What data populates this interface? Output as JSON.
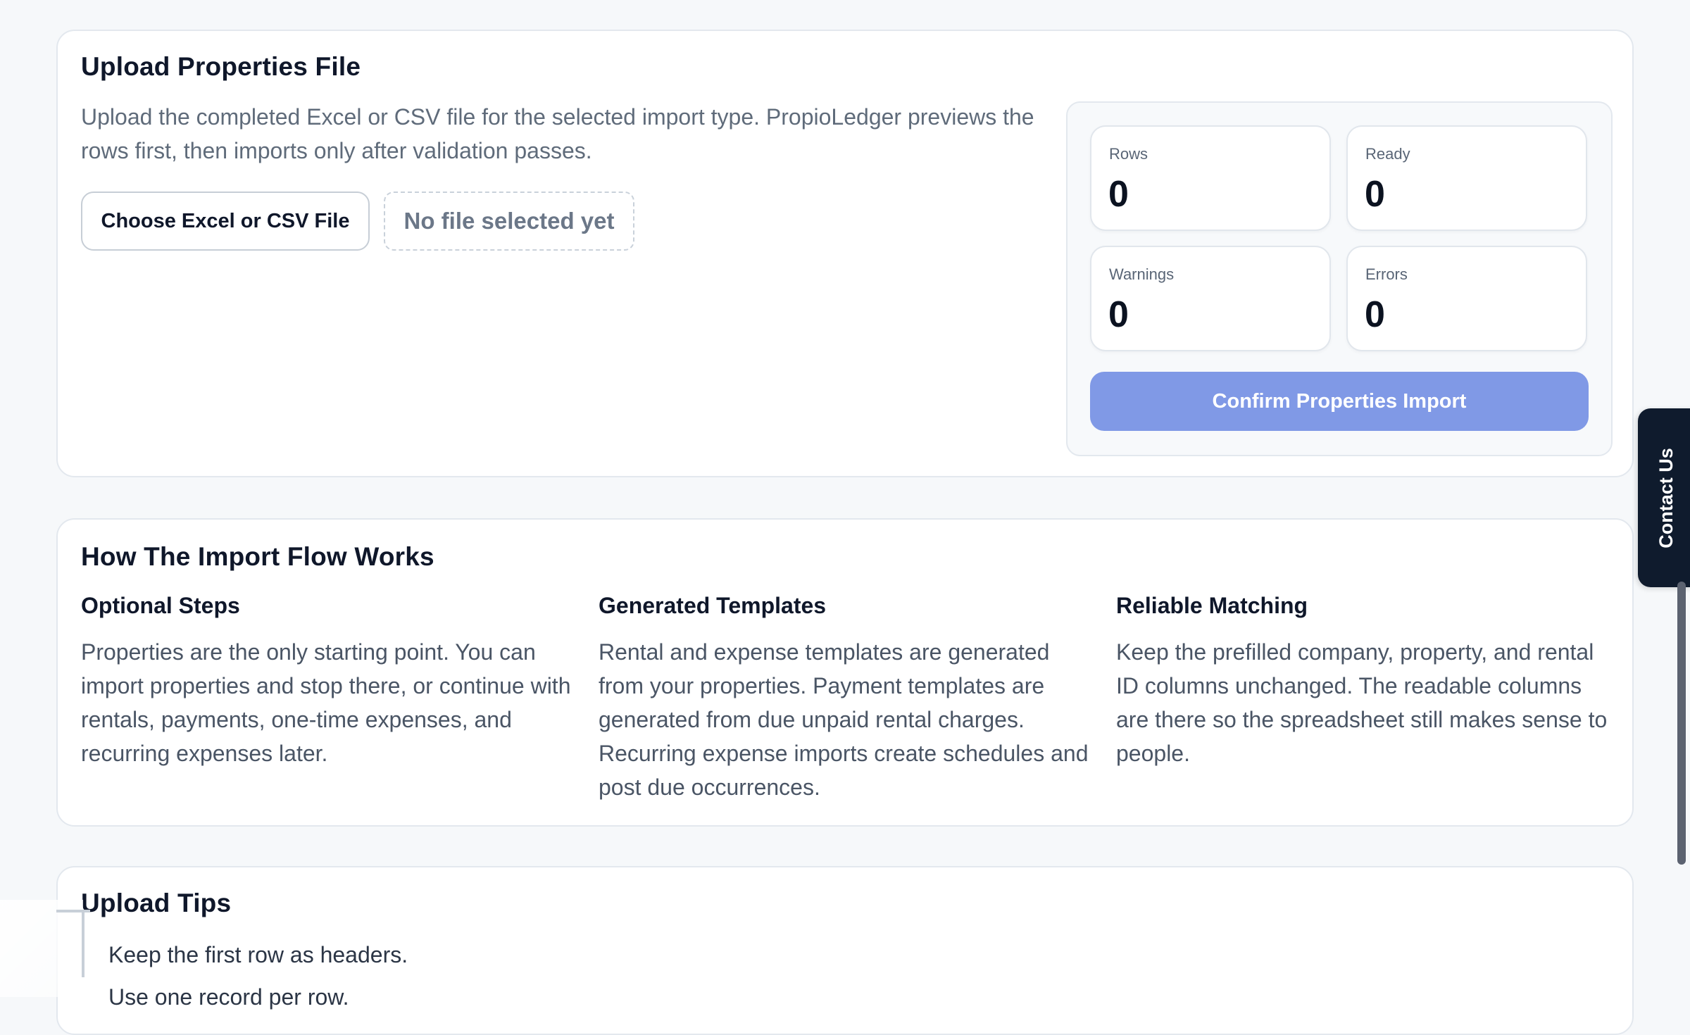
{
  "upload": {
    "title": "Upload Properties File",
    "intro": "Upload the completed Excel or CSV file for the selected import type. PropioLedger previews the rows first, then imports only after validation passes.",
    "choose_button": "Choose Excel or CSV File",
    "file_status": "No file selected yet",
    "stats": {
      "rows": {
        "label": "Rows",
        "value": "0"
      },
      "ready": {
        "label": "Ready",
        "value": "0"
      },
      "warnings": {
        "label": "Warnings",
        "value": "0"
      },
      "errors": {
        "label": "Errors",
        "value": "0"
      }
    },
    "confirm_button": "Confirm Properties Import"
  },
  "flow": {
    "title": "How The Import Flow Works",
    "columns": [
      {
        "heading": "Optional Steps",
        "body": "Properties are the only starting point. You can import properties and stop there, or continue with rentals, payments, one-time expenses, and recurring expenses later."
      },
      {
        "heading": "Generated Templates",
        "body": "Rental and expense templates are generated from your properties. Payment templates are generated from due unpaid rental charges. Recurring expense imports create schedules and post due occurrences."
      },
      {
        "heading": "Reliable Matching",
        "body": "Keep the prefilled company, property, and rental ID columns unchanged. The readable columns are there so the spreadsheet still makes sense to people."
      }
    ]
  },
  "tips": {
    "title": "Upload Tips",
    "items": [
      "Keep the first row as headers.",
      "Use one record per row."
    ]
  },
  "contact_tab": {
    "label": "Contact Us"
  },
  "colors": {
    "primary_disabled": "#8099e6",
    "contact_tab_bg": "#0f1b2d",
    "page_bg": "#f6f8fa"
  }
}
